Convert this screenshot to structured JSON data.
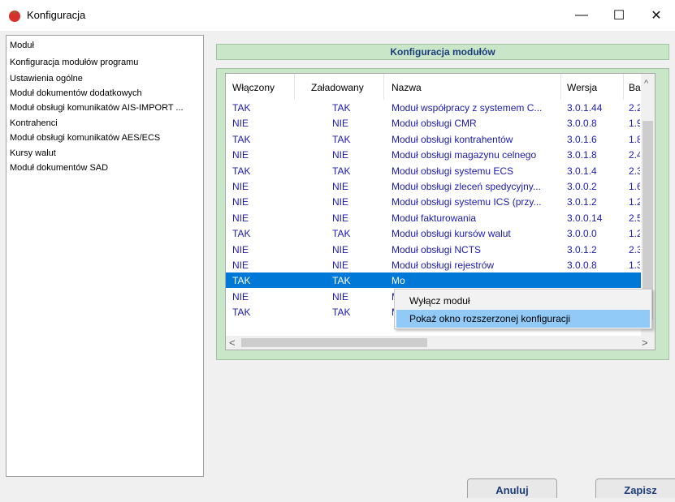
{
  "window": {
    "title": "Konfiguracja",
    "minimize": "—",
    "maximize": "☐",
    "close": "✕"
  },
  "sidebar": {
    "items": [
      "Moduł",
      "Konfiguracja modułów programu",
      "Ustawienia ogólne",
      "Moduł dokumentów dodatkowych",
      "Moduł obsługi komunikatów AIS-IMPORT ...",
      "Kontrahenci",
      "Moduł obsługi komunikatów AES/ECS",
      "Kursy walut",
      "Moduł dokumentów SAD"
    ]
  },
  "main": {
    "header": "Konfiguracja modułów"
  },
  "grid": {
    "columns": [
      "Włączony",
      "Załadowany",
      "Nazwa",
      "Wersja",
      "Ba"
    ],
    "rows": [
      [
        "TAK",
        "TAK",
        "Moduł współpracy z systemem C...",
        "3.0.1.44",
        "2.2"
      ],
      [
        "NIE",
        "NIE",
        "Moduł obsługi CMR",
        "3.0.0.8",
        "1.9"
      ],
      [
        "TAK",
        "TAK",
        "Moduł obsługi kontrahentów",
        "3.0.1.6",
        "1.8"
      ],
      [
        "NIE",
        "NIE",
        "Moduł obsługi magazynu celnego",
        "3.0.1.8",
        "2.4"
      ],
      [
        "TAK",
        "TAK",
        "Moduł obsługi systemu ECS",
        "3.0.1.4",
        "2.3"
      ],
      [
        "NIE",
        "NIE",
        "Moduł obsługi zleceń spedycyjny...",
        "3.0.0.2",
        "1.6"
      ],
      [
        "NIE",
        "NIE",
        "Moduł obsługi systemu ICS (przy...",
        "3.0.1.2",
        "1.2"
      ],
      [
        "NIE",
        "NIE",
        "Moduł fakturowania",
        "3.0.0.14",
        "2.5"
      ],
      [
        "TAK",
        "TAK",
        "Moduł obsługi kursów walut",
        "3.0.0.0",
        "1.2"
      ],
      [
        "NIE",
        "NIE",
        "Moduł obsługi NCTS",
        "3.0.1.2",
        "2.3"
      ],
      [
        "NIE",
        "NIE",
        "Moduł obsługi rejestrów",
        "3.0.0.8",
        "1.3"
      ],
      [
        "TAK",
        "TAK",
        "Mo",
        "",
        ""
      ],
      [
        "NIE",
        "NIE",
        "Mo",
        "",
        ""
      ],
      [
        "TAK",
        "TAK",
        "Mo",
        "",
        ""
      ]
    ],
    "selected_row": 11
  },
  "context_menu": {
    "items": [
      "Wyłącz moduł",
      "Pokaż okno rozszerzonej konfiguracji"
    ]
  },
  "buttons": {
    "cancel": "Anuluj",
    "save": "Zapisz"
  },
  "colors": {
    "header_bg": "#c9e6c9",
    "selection": "#0078d7",
    "link_text": "#1a1ab0",
    "menu_highlight": "#91c9f7"
  }
}
